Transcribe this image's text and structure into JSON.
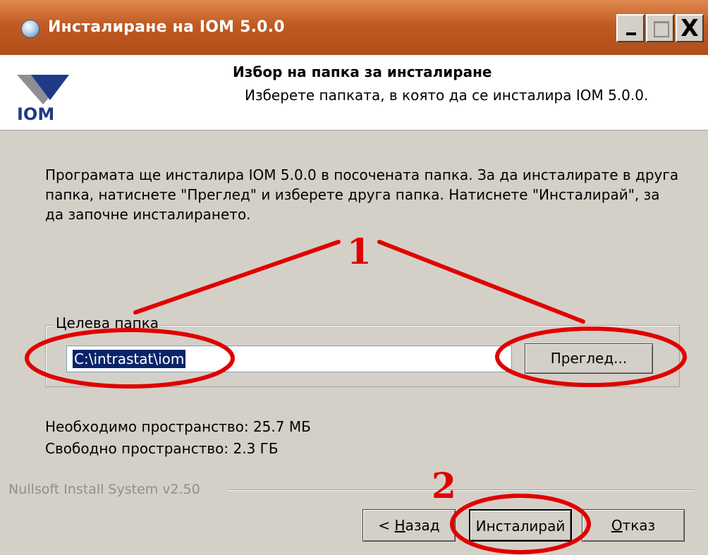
{
  "window": {
    "title": "Инсталиране на IOM 5.0.0",
    "caption_buttons": {
      "minimize": "_",
      "maximize": "□",
      "close": "X"
    }
  },
  "header": {
    "title": "Избор на папка за инсталиране",
    "subtitle": "Изберете папката, в която да се инсталира IOM 5.0.0.",
    "logo_text": "IOM"
  },
  "body": {
    "description": "Програмата ще инсталира IOM 5.0.0 в посочената папка. За да инсталирате в друга папка, натиснете \"Преглед\" и изберете друга папка. Натиснете \"Инсталирай\", за да започне инсталирането.",
    "group_label": "Целева папка",
    "path_value": "C:\\intrastat\\iom",
    "browse_label": "Преглед...",
    "space_required": "Необходимо пространство: 25.7 МБ",
    "space_free": "Свободно пространство: 2.3 ГБ"
  },
  "footer": {
    "nsis": "Nullsoft Install System v2.50",
    "back_prefix": "< ",
    "back_hotkey": "Н",
    "back_rest": "азад",
    "install_label": "Инсталирай",
    "cancel_hotkey": "О",
    "cancel_rest": "тказ"
  },
  "annotations": {
    "step1": "1",
    "step2": "2"
  },
  "colors": {
    "titlebar": "#c05a22",
    "annotation": "#e00000",
    "selection": "#0a246a",
    "dialog": "#d4d0c8"
  }
}
